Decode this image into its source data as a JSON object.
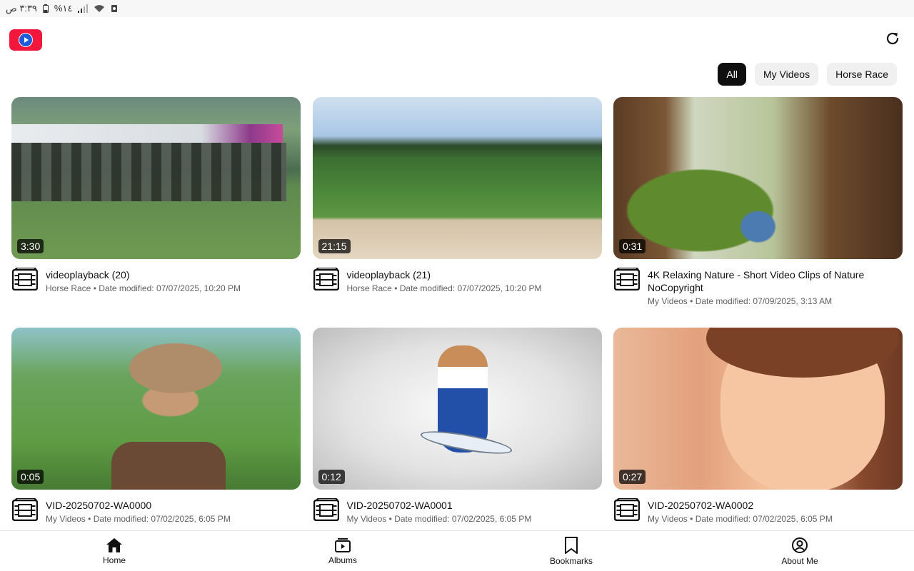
{
  "status_bar": {
    "time": "٣:٣٩ ص",
    "battery": "%١٤"
  },
  "filters": [
    {
      "label": "All",
      "active": true
    },
    {
      "label": "My Videos",
      "active": false
    },
    {
      "label": "Horse Race",
      "active": false
    }
  ],
  "videos": [
    {
      "title": "videoplayback (20)",
      "album": "Horse Race",
      "date": "Date modified: 07/07/2025, 10:20 PM",
      "duration": "3:30"
    },
    {
      "title": "videoplayback (21)",
      "album": "Horse Race",
      "date": "Date modified: 07/07/2025, 10:20 PM",
      "duration": "21:15"
    },
    {
      "title": "4K Relaxing Nature - Short Video Clips of Nature NoCopyright",
      "album": "My Videos",
      "date": "Date modified: 07/09/2025, 3:13 AM",
      "duration": "0:31"
    },
    {
      "title": "VID-20250702-WA0000",
      "album": "My Videos",
      "date": "Date modified: 07/02/2025, 6:05 PM",
      "duration": "0:05"
    },
    {
      "title": "VID-20250702-WA0001",
      "album": "My Videos",
      "date": "Date modified: 07/02/2025, 6:05 PM",
      "duration": "0:12"
    },
    {
      "title": "VID-20250702-WA0002",
      "album": "My Videos",
      "date": "Date modified: 07/02/2025, 6:05 PM",
      "duration": "0:27"
    }
  ],
  "meta_separator": " • ",
  "bottom_nav": [
    {
      "label": "Home",
      "icon": "home-icon",
      "active": true
    },
    {
      "label": "Albums",
      "icon": "albums-icon",
      "active": false
    },
    {
      "label": "Bookmarks",
      "icon": "bookmark-icon",
      "active": false
    },
    {
      "label": "About Me",
      "icon": "account-icon",
      "active": false
    }
  ],
  "colors": {
    "brand_red": "#f2183d",
    "chip_active_bg": "#0f0f0f",
    "chip_bg": "#f0f0f0",
    "secondary_text": "#606060"
  }
}
